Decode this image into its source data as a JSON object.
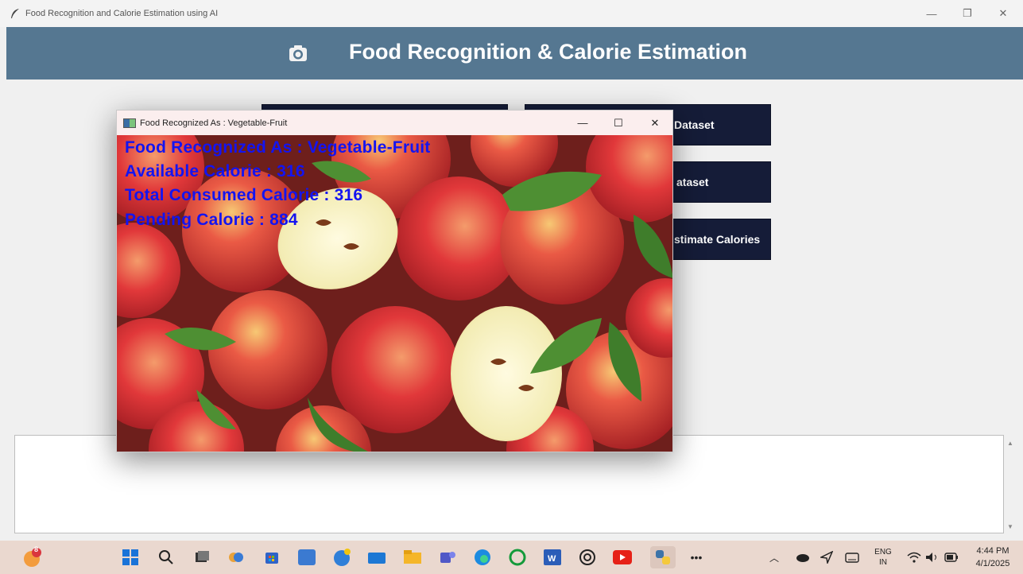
{
  "window": {
    "title": "Food Recognition and Calorie Estimation using AI"
  },
  "header": {
    "title": "Food Recognition & Calorie Estimation"
  },
  "buttons": {
    "upload_dataset": "Dataset",
    "preprocess_dataset": "ataset",
    "estimate_calories": "stimate Calories"
  },
  "popup": {
    "title": "Food Recognized As : Vegetable-Fruit",
    "overlay_lines": [
      "Food Recognized As : Vegetable-Fruit",
      "Available Calorie  : 316",
      "Total Consumed Calorie  : 316",
      "Pending Calorie  : 884"
    ]
  },
  "taskbar": {
    "notification_badge": "8",
    "language_line1": "ENG",
    "language_line2": "IN",
    "time": "4:44 PM",
    "date": "4/1/2025"
  },
  "colors": {
    "header": "#557791",
    "button": "#151c38",
    "overlay_text": "#1414f0",
    "taskbar": "#ead8cf"
  }
}
